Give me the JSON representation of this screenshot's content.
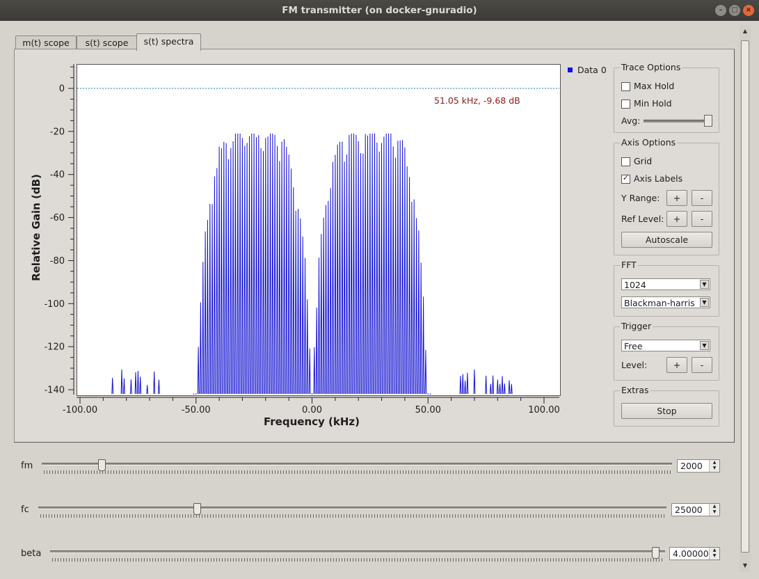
{
  "window": {
    "title": "FM transmitter (on docker-gnuradio)"
  },
  "tabs": [
    {
      "label": "m(t) scope",
      "active": false
    },
    {
      "label": "s(t) scope",
      "active": false
    },
    {
      "label": "s(t) spectra",
      "active": true
    }
  ],
  "plot": {
    "legend": "Data 0",
    "cursor_readout": "51.05 kHz, -9.68 dB",
    "reference_line_db": 0
  },
  "chart_data": {
    "type": "line",
    "xlabel": "Frequency (kHz)",
    "ylabel": "Relative Gain (dB)",
    "xlim": [
      -100,
      100
    ],
    "ylim": [
      -140,
      10
    ],
    "xticks": [
      "-100.00",
      "-50.00",
      "0.00",
      "50.00",
      "100.00"
    ],
    "yticks": [
      "0",
      "-20",
      "-40",
      "-60",
      "-80",
      "-100",
      "-120",
      "-140"
    ],
    "series": [
      {
        "name": "Data 0",
        "color": "#1010d0",
        "lobes": [
          {
            "center_khz": -25,
            "half_width_khz": 25,
            "peak_db": -22
          },
          {
            "center_khz": 25,
            "half_width_khz": 25,
            "peak_db": -22
          }
        ],
        "side_spurs": [
          {
            "center_khz": -75,
            "peak_db": -130
          },
          {
            "center_khz": 75,
            "peak_db": -130
          }
        ],
        "line_spacing_khz": 2
      }
    ],
    "grid": false
  },
  "trace_options": {
    "title": "Trace Options",
    "max_hold": "Max Hold",
    "min_hold": "Min Hold",
    "avg": "Avg:",
    "max_hold_checked": false,
    "min_hold_checked": false,
    "avg_level": 1.0
  },
  "axis_options": {
    "title": "Axis Options",
    "grid": "Grid",
    "axis_labels": "Axis Labels",
    "grid_checked": false,
    "axis_labels_checked": true,
    "y_range": "Y Range:",
    "ref_level": "Ref Level:",
    "plus": "+",
    "minus": "-",
    "autoscale": "Autoscale"
  },
  "fft": {
    "title": "FFT",
    "size": "1024",
    "window": "Blackman-harris"
  },
  "trigger": {
    "title": "Trigger",
    "mode": "Free",
    "level": "Level:",
    "plus": "+",
    "minus": "-"
  },
  "extras": {
    "title": "Extras",
    "stop": "Stop"
  },
  "sliders": [
    {
      "label": "fm",
      "value": "2000",
      "fraction": 0.09
    },
    {
      "label": "fc",
      "value": "25000",
      "fraction": 0.25
    },
    {
      "label": "beta",
      "value": "4.00000",
      "fraction": 0.99
    }
  ]
}
